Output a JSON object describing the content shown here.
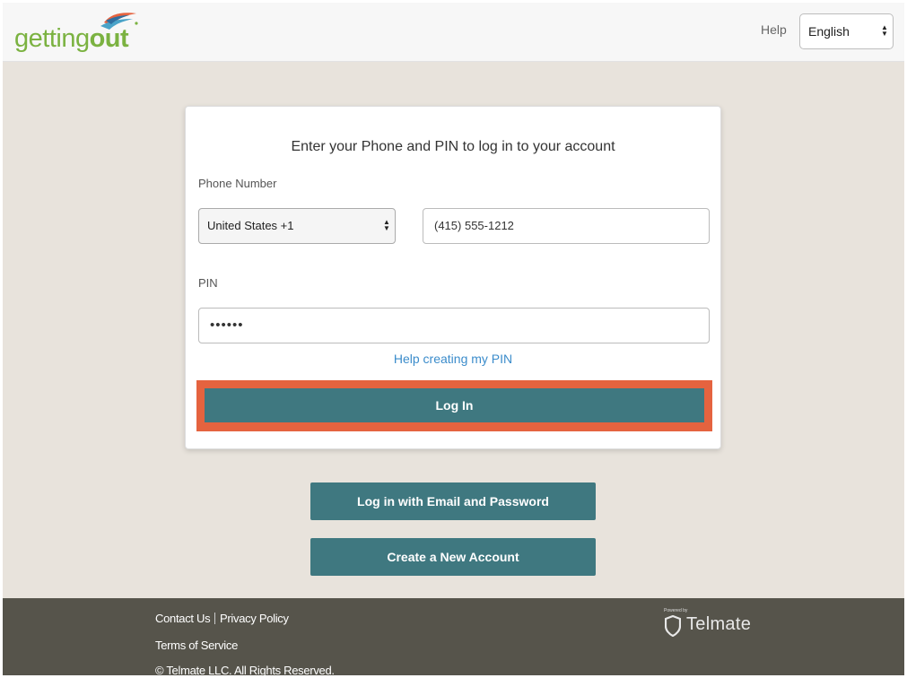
{
  "header": {
    "logo_getting": "getting",
    "logo_out": "out",
    "help_label": "Help",
    "language_selected": "English"
  },
  "login_card": {
    "title": "Enter your Phone and PIN to log in to your account",
    "phone_label": "Phone Number",
    "country_selected": "United States +1",
    "phone_value": "(415) 555-1212",
    "pin_label": "PIN",
    "pin_value": "••••••",
    "help_pin_label": "Help creating my PIN",
    "login_label": "Log In"
  },
  "actions": {
    "email_login_label": "Log in with Email and Password",
    "create_account_label": "Create a New Account"
  },
  "footer": {
    "contact_label": "Contact Us",
    "privacy_label": "Privacy Policy",
    "terms_label": "Terms of Service",
    "copyright": "© Telmate LLC. All Rights Reserved.",
    "powered_by": "Powered by",
    "telmate": "Telmate"
  },
  "colors": {
    "brand_green": "#7bb241",
    "button_teal": "#3f7880",
    "highlight_orange": "#e5633f",
    "footer_bg": "#56544b",
    "page_bg": "#e8e3dc",
    "link_blue": "#3b8ccb"
  },
  "icons": {
    "logo_mark": "swoosh-logo-icon",
    "select_arrows": "updown-arrows-icon",
    "telmate_shield": "shield-icon"
  }
}
